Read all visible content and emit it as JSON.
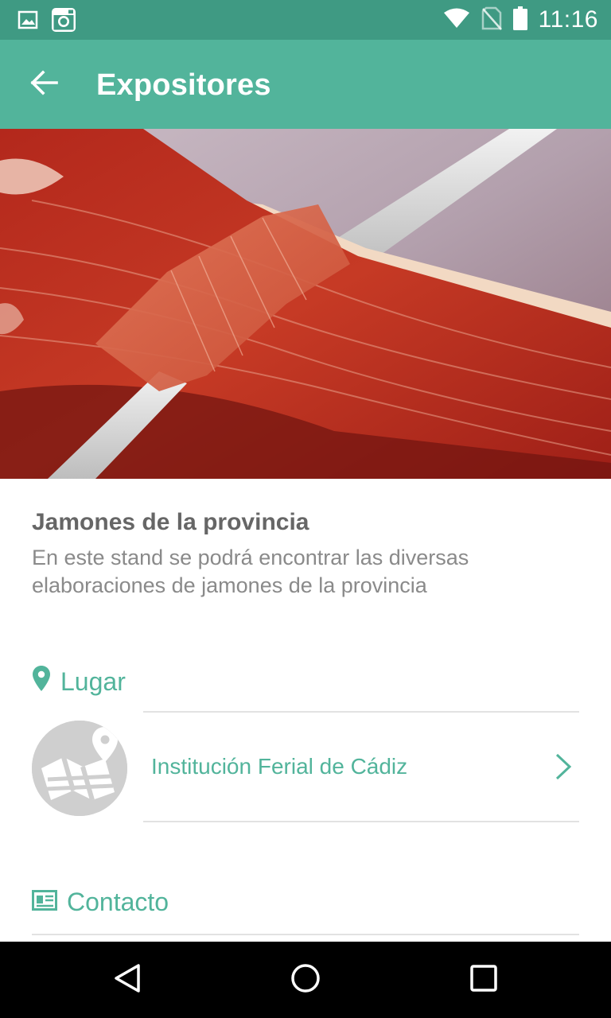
{
  "status_bar": {
    "time": "11:16",
    "left_icons": [
      "image-icon",
      "instagram-icon"
    ],
    "right_icons": [
      "wifi-icon",
      "no-sim-icon",
      "battery-icon"
    ]
  },
  "app_bar": {
    "title": "Expositores",
    "back_icon": "arrow-back-icon",
    "background": "#52b49b"
  },
  "hero": {
    "subject": "sliced cured ham with knife"
  },
  "exhibitor": {
    "title": "Jamones de la provincia",
    "description": "En este stand se podrá encontrar las diversas elaboraciones de jamones de la provincia"
  },
  "location_section": {
    "heading": "Lugar",
    "icon": "location-pin-icon",
    "place_name": "Institución Ferial de Cádiz",
    "avatar_icon": "map-icon",
    "chevron_icon": "chevron-right-icon"
  },
  "contact_section": {
    "heading": "Contacto",
    "icon": "contact-card-icon"
  },
  "nav_bar": {
    "buttons": [
      "back-triangle-icon",
      "home-circle-icon",
      "recents-square-icon"
    ]
  },
  "colors": {
    "accent": "#52b49b",
    "status_bar": "#3f9a83",
    "title_text": "#666666",
    "body_text": "#8a8a8a"
  }
}
